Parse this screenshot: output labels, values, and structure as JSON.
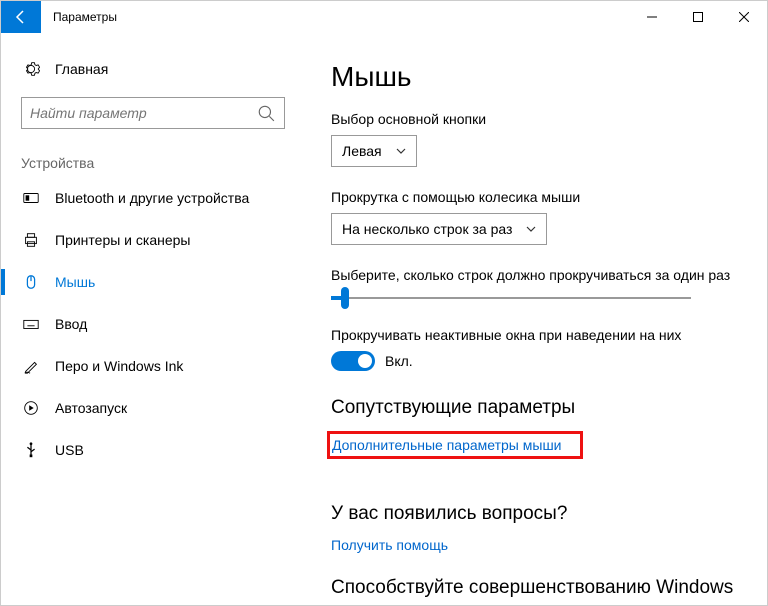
{
  "window": {
    "title": "Параметры"
  },
  "sidebar": {
    "home": "Главная",
    "search_placeholder": "Найти параметр",
    "section": "Устройства",
    "items": [
      {
        "label": "Bluetooth и другие устройства",
        "active": false
      },
      {
        "label": "Принтеры и сканеры",
        "active": false
      },
      {
        "label": "Мышь",
        "active": true
      },
      {
        "label": "Ввод",
        "active": false
      },
      {
        "label": "Перо и Windows Ink",
        "active": false
      },
      {
        "label": "Автозапуск",
        "active": false
      },
      {
        "label": "USB",
        "active": false
      }
    ]
  },
  "main": {
    "title": "Мышь",
    "primary_button_label": "Выбор основной кнопки",
    "primary_button_value": "Левая",
    "scroll_label": "Прокрутка с помощью колесика мыши",
    "scroll_value": "На несколько строк за раз",
    "lines_label": "Выберите, сколько строк должно прокручиваться за один раз",
    "inactive_label": "Прокручивать неактивные окна при наведении на них",
    "toggle_state": "Вкл.",
    "related_header": "Сопутствующие параметры",
    "related_link": "Дополнительные параметры мыши",
    "help_header": "У вас появились вопросы?",
    "help_link": "Получить помощь",
    "cutoff": "Способствуйте совершенствованию Windows"
  }
}
